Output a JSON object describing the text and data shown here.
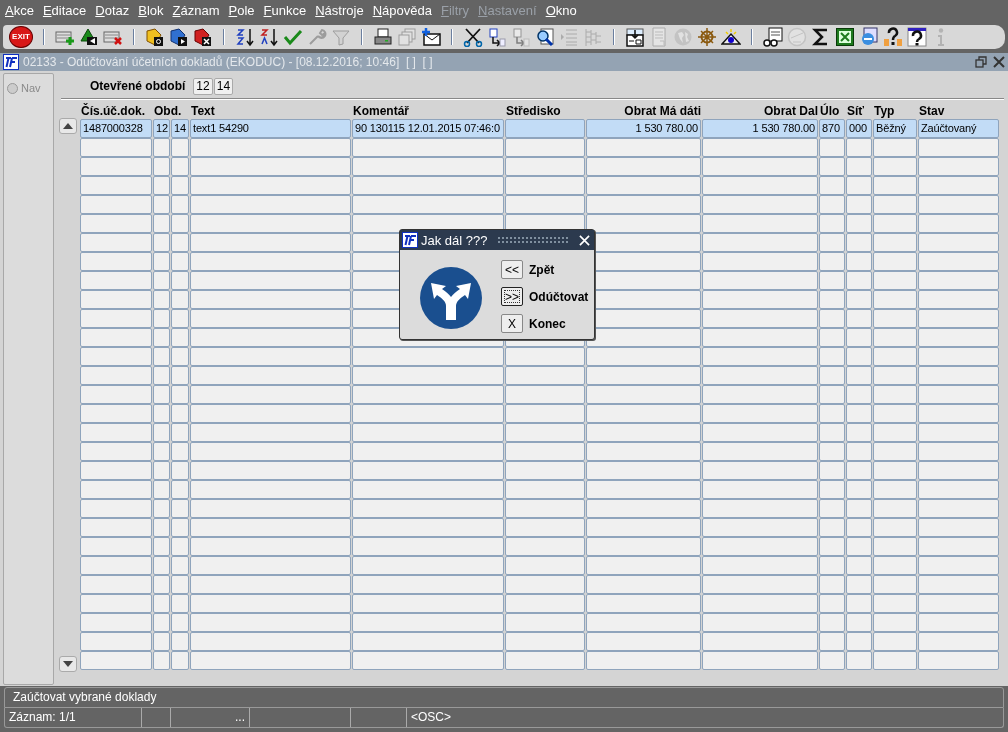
{
  "menu": [
    {
      "label": "Akce",
      "disabled": false
    },
    {
      "label": "Editace",
      "disabled": false
    },
    {
      "label": "Dotaz",
      "disabled": false
    },
    {
      "label": "Blok",
      "disabled": false
    },
    {
      "label": "Záznam",
      "disabled": false
    },
    {
      "label": "Pole",
      "disabled": false
    },
    {
      "label": "Funkce",
      "disabled": false
    },
    {
      "label": "Nástroje",
      "disabled": false
    },
    {
      "label": "Nápověda",
      "disabled": false
    },
    {
      "label": "Filtry",
      "disabled": true
    },
    {
      "label": "Nastavení",
      "disabled": true
    },
    {
      "label": "Okno",
      "disabled": false
    }
  ],
  "toolbar": {
    "exit_label": "EXIT",
    "groups": [
      [
        {
          "kind": "insert",
          "disabled": false
        },
        {
          "kind": "save",
          "disabled": false
        },
        {
          "kind": "delete",
          "disabled": false
        }
      ],
      [
        {
          "kind": "query",
          "disabled": false
        },
        {
          "kind": "execute",
          "disabled": false
        },
        {
          "kind": "cancel",
          "disabled": false
        }
      ],
      [
        {
          "kind": "sort-asc",
          "disabled": false
        },
        {
          "kind": "sort-desc",
          "disabled": false
        },
        {
          "kind": "check",
          "disabled": false
        },
        {
          "kind": "wrench",
          "disabled": true
        },
        {
          "kind": "filter",
          "disabled": true
        }
      ],
      [
        {
          "kind": "print",
          "disabled": false
        },
        {
          "kind": "copies",
          "disabled": true
        },
        {
          "kind": "mail",
          "disabled": false
        }
      ],
      [
        {
          "kind": "scissors",
          "disabled": false
        },
        {
          "kind": "translate",
          "disabled": false
        },
        {
          "kind": "translate",
          "disabled": true
        },
        {
          "kind": "zoom",
          "disabled": false
        },
        {
          "kind": "list",
          "disabled": true
        },
        {
          "kind": "tree",
          "disabled": true
        }
      ],
      [
        {
          "kind": "import",
          "disabled": false
        },
        {
          "kind": "document",
          "disabled": true
        },
        {
          "kind": "globe",
          "disabled": true
        },
        {
          "kind": "wheel",
          "disabled": false
        },
        {
          "kind": "eye",
          "disabled": false
        }
      ],
      [
        {
          "kind": "glasses",
          "disabled": false
        },
        {
          "kind": "clock",
          "disabled": true
        },
        {
          "kind": "sigma",
          "disabled": false
        },
        {
          "kind": "excel",
          "disabled": false
        },
        {
          "kind": "browser",
          "disabled": false
        },
        {
          "kind": "help-people",
          "disabled": false
        },
        {
          "kind": "help",
          "disabled": false
        },
        {
          "kind": "info",
          "disabled": true
        }
      ]
    ]
  },
  "window": {
    "title": "02133 - Odúčtování účetních dokladů (EKODUC) - [08.12.2016; 10:46]  [ ]  [ ]",
    "active": false
  },
  "nav": {
    "label": "Nav",
    "selected": false
  },
  "periods": {
    "label": "Otevřené období",
    "values": [
      "12",
      "14"
    ]
  },
  "table": {
    "columns": [
      "Čís.úč.dok.",
      "Obd.",
      null,
      "Text",
      "Komentář",
      "Středisko",
      "Obrat Má dáti",
      "Obrat Dal",
      "Úlo",
      "Síť",
      "Typ",
      "Stav"
    ],
    "rows": [
      {
        "selected": true,
        "cells": [
          "1487000328",
          "12",
          "14",
          "text1 54290",
          "90 130115 12.01.2015 07:46:0",
          null,
          "1 530 780.00",
          "1 530 780.00",
          "870",
          "000",
          "Běžný",
          "Zaúčtovaný"
        ]
      }
    ]
  },
  "dialog": {
    "title": "Jak dál ???",
    "buttons": [
      {
        "key": "<<",
        "label": "Zpět",
        "focused": false
      },
      {
        "key": ">>",
        "label": "Odúčtovat",
        "focused": true
      },
      {
        "key": "X",
        "label": "Konec",
        "focused": false
      }
    ]
  },
  "status_bar": {
    "message": "Zaúčtovat vybrané doklady",
    "record": "Záznam: 1/1",
    "indicator": "...",
    "mode": "<OSC>"
  }
}
